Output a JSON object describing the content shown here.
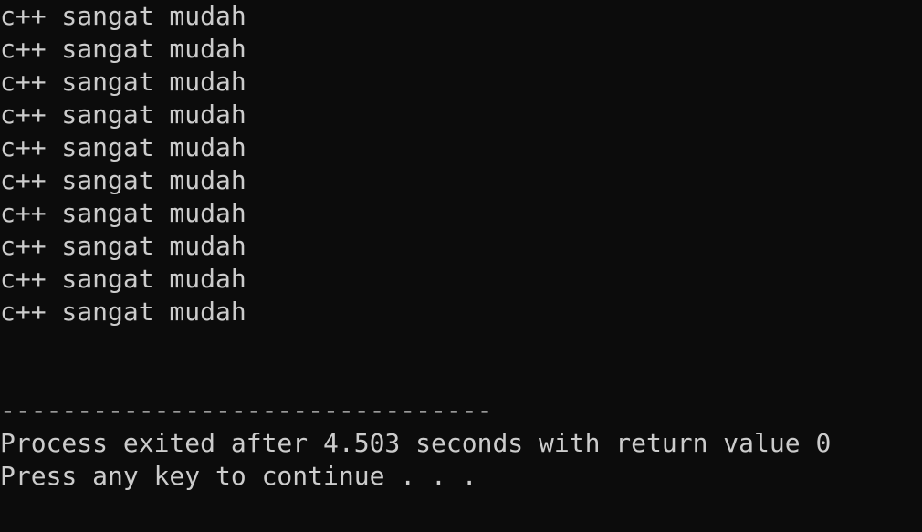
{
  "console": {
    "output_lines": [
      "c++ sangat mudah",
      "c++ sangat mudah",
      "c++ sangat mudah",
      "c++ sangat mudah",
      "c++ sangat mudah",
      "c++ sangat mudah",
      "c++ sangat mudah",
      "c++ sangat mudah",
      "c++ sangat mudah",
      "c++ sangat mudah"
    ],
    "separator": "--------------------------------",
    "exit_message": "Process exited after 4.503 seconds with return value 0",
    "continue_prompt": "Press any key to continue . . ."
  },
  "colors": {
    "background": "#0c0c0c",
    "text": "#cccccc"
  }
}
